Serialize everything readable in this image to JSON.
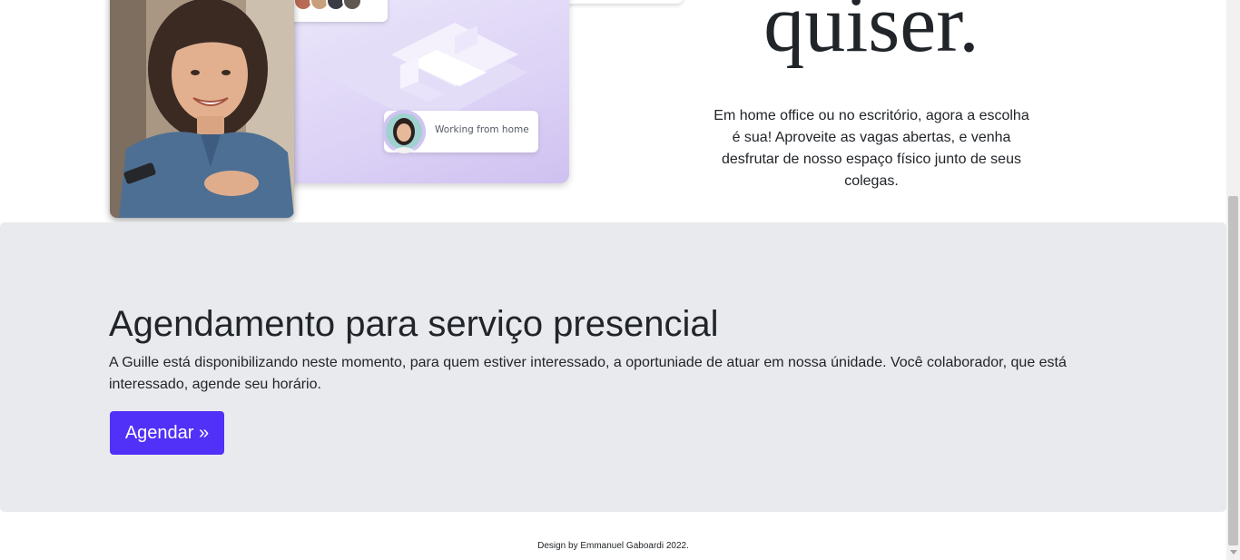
{
  "hero": {
    "heading": "quiser.",
    "paragraph": "Em home office ou no escritório, agora a escolha é sua! Aproveite as vagas abertas, e venha desfrutar de nosso espaço físico junto de seus colegas.",
    "illustration": {
      "status_label": "Working from home"
    }
  },
  "jumbotron": {
    "title": "Agendamento para serviço presencial",
    "lead": "A Guille está disponibilizando neste momento, para quem estiver interessado, a oportuniade de atuar em nossa únidade. Você colaborador, que está interessado, agende seu horário.",
    "button_label": "Agendar »",
    "button_color": "#5130f7",
    "background_color": "#e9eaee"
  },
  "footer": {
    "credit": "Design by Emmanuel Gaboardi 2022."
  }
}
